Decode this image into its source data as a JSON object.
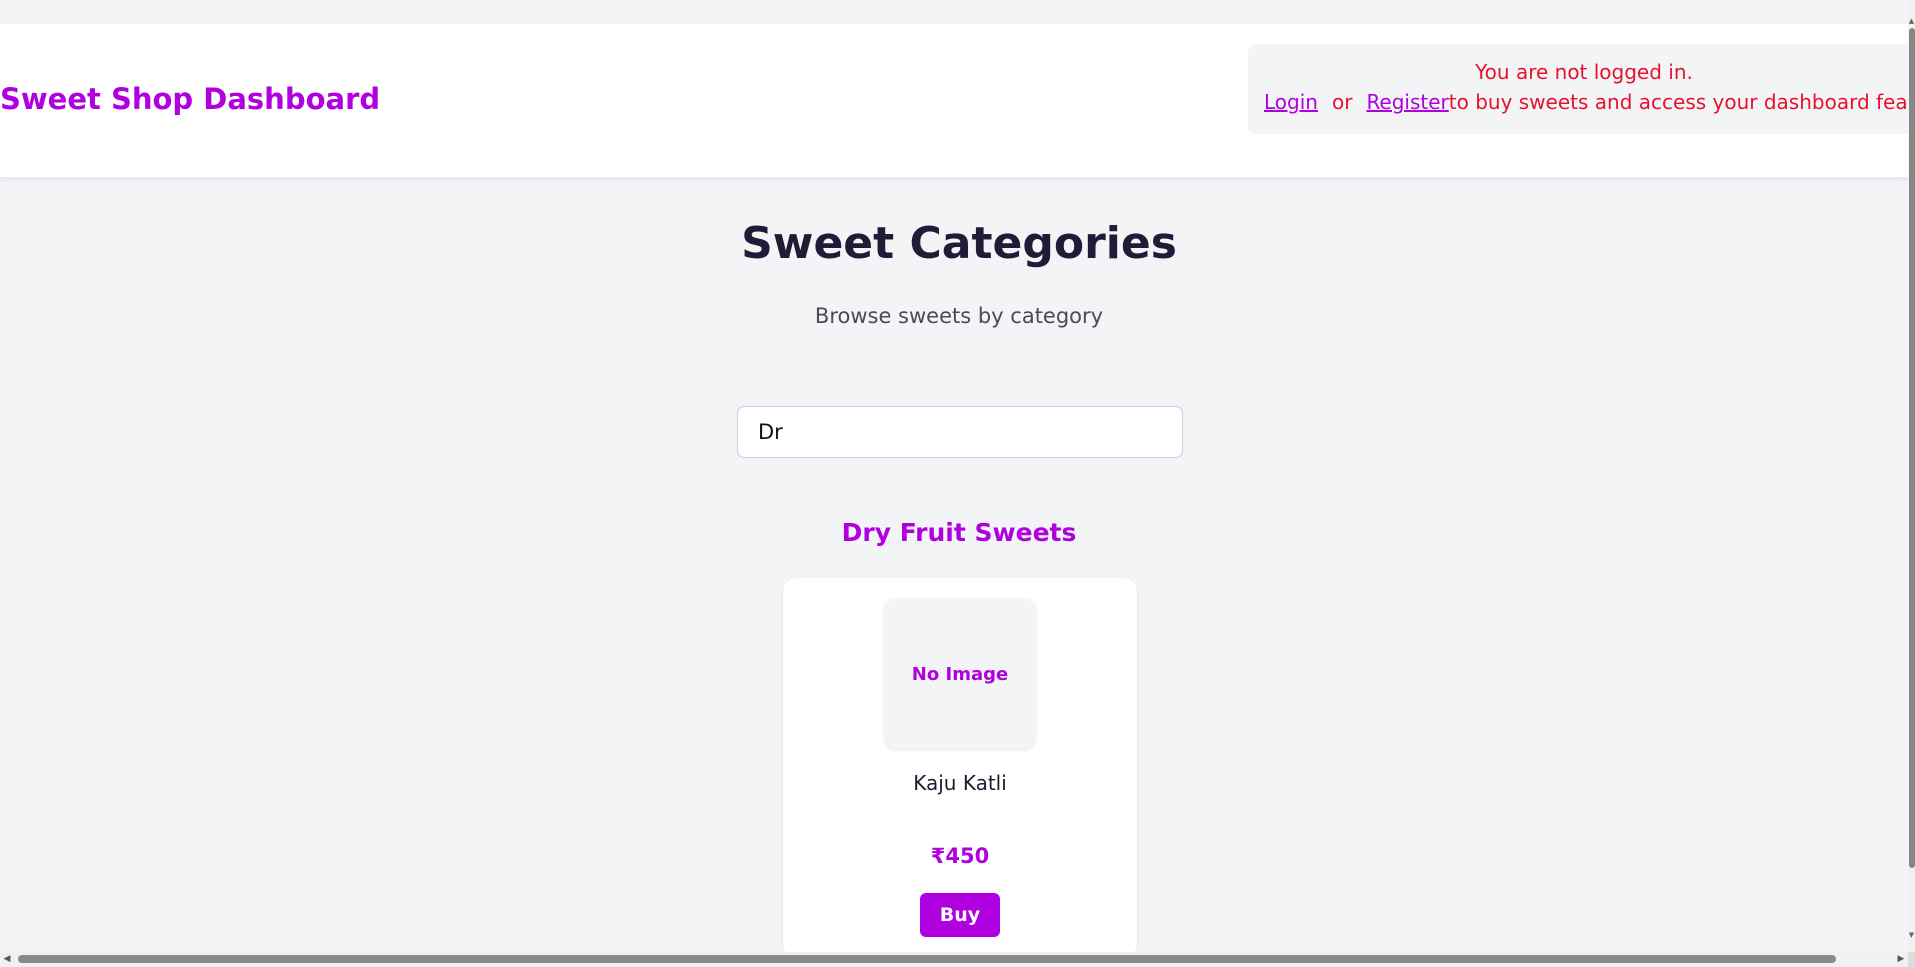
{
  "header": {
    "brand": "Sweet Shop Dashboard",
    "auth": {
      "message": "You are not logged in.",
      "login_label": "Login",
      "or_label": "or",
      "register_label": "Register",
      "suffix": "to buy sweets and access your dashboard features."
    }
  },
  "main": {
    "title": "Sweet Categories",
    "subtitle": "Browse sweets by category",
    "search": {
      "value": "Dr",
      "placeholder": ""
    },
    "categories": [
      {
        "name": "Dry Fruit Sweets",
        "items": [
          {
            "image_placeholder": "No Image",
            "name": "Kaju Katli",
            "price": "₹450",
            "buy_label": "Buy"
          }
        ]
      }
    ]
  },
  "colors": {
    "accent": "#b000e0",
    "warning_text": "#e8112d",
    "background": "#f3f4f6"
  },
  "icons": {
    "scroll_up": "triangle-up-icon",
    "scroll_down": "triangle-down-icon",
    "scroll_left": "triangle-left-icon",
    "scroll_right": "triangle-right-icon"
  }
}
